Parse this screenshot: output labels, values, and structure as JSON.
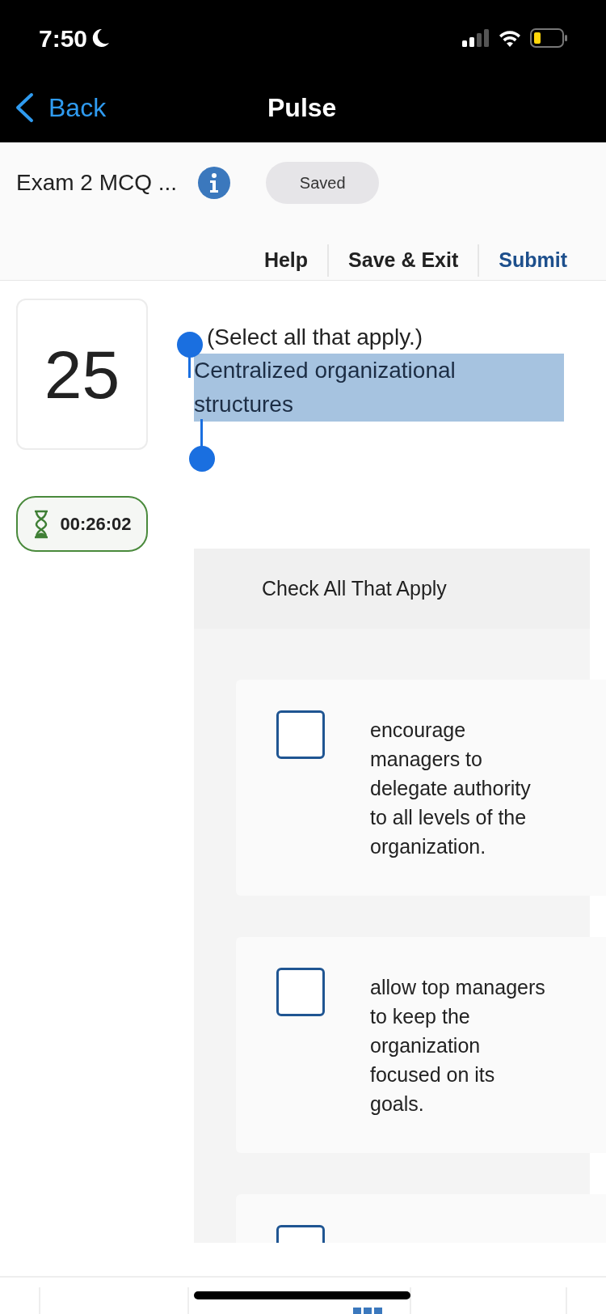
{
  "status_bar": {
    "time": "7:50"
  },
  "nav": {
    "back": "Back",
    "title": "Pulse"
  },
  "header": {
    "title": "Exam 2 MCQ ...",
    "save_status": "Saved"
  },
  "toolbar": [
    {
      "label": "Help",
      "kind": "plain"
    },
    {
      "label": "Save & Exit",
      "kind": "plain"
    },
    {
      "label": "Submit",
      "kind": "primary"
    }
  ],
  "question": {
    "number": "25",
    "timer": "00:26:02",
    "instruction": "(Select all that apply.)",
    "prompt": "Centralized organizational structures",
    "prompt_selected": true
  },
  "answers": {
    "heading": "Check All That Apply",
    "options": [
      {
        "text": "encourage managers to delegate authority to all levels of the organization.",
        "checked": false
      },
      {
        "text": "allow top managers to keep the organization focused on its goals.",
        "checked": false
      },
      {
        "checked": false
      }
    ]
  }
}
